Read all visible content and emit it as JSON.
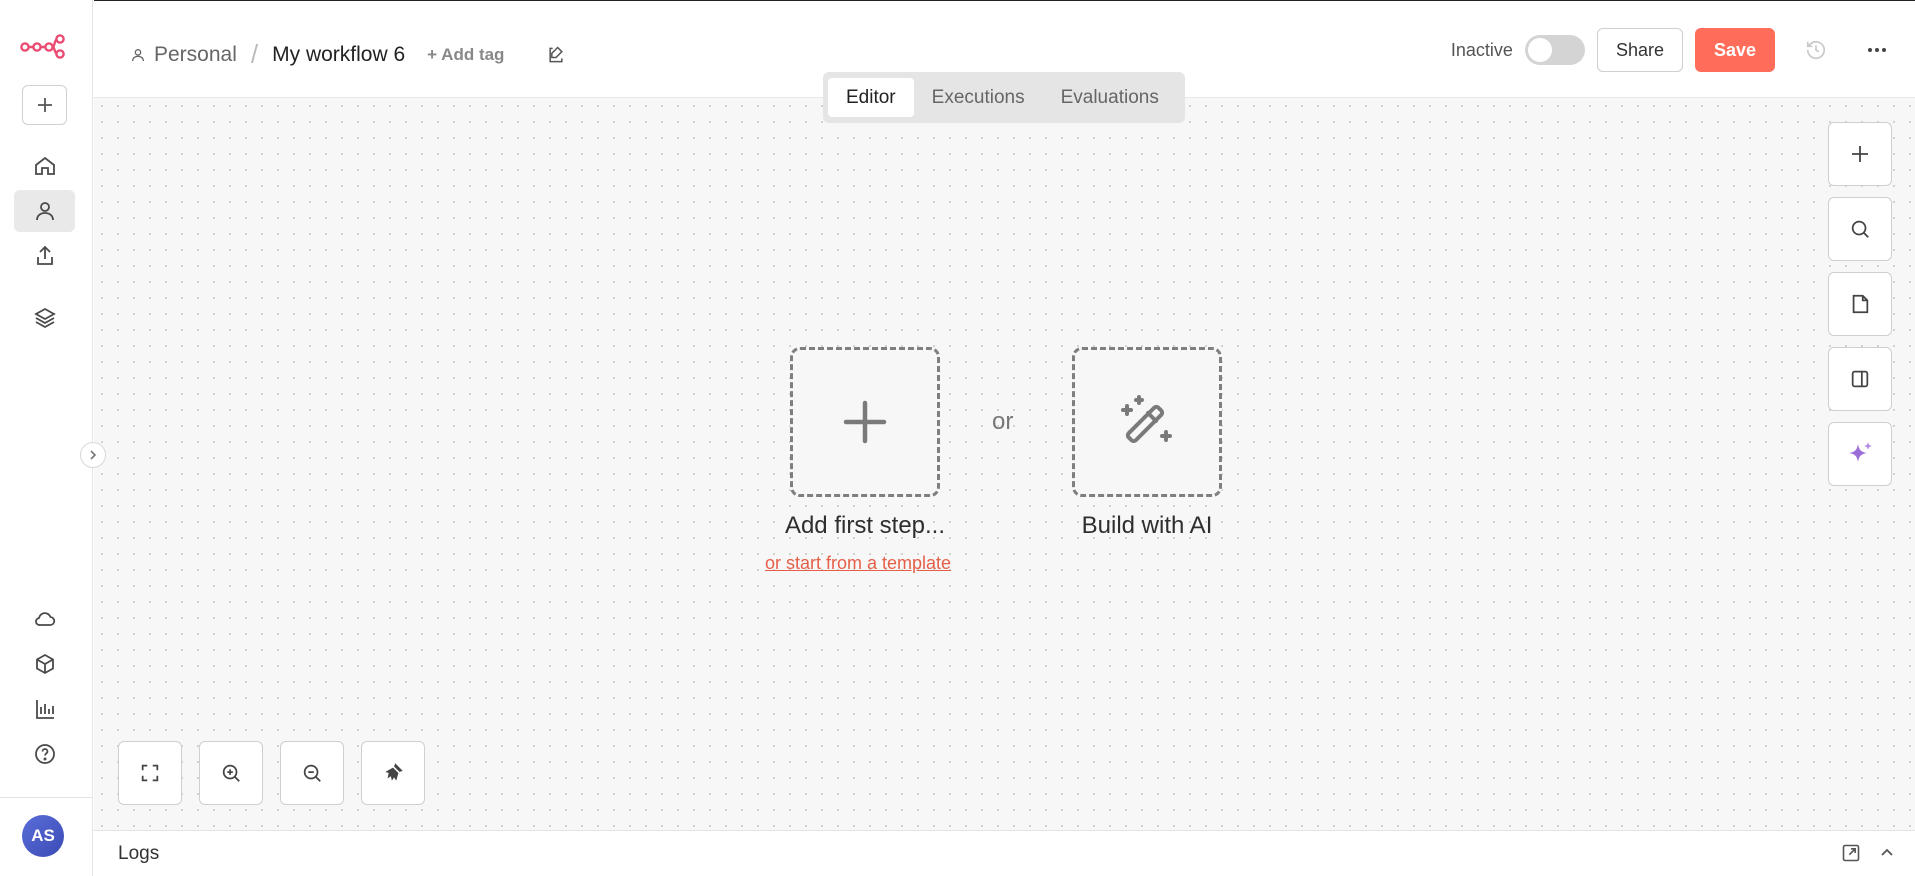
{
  "header": {
    "breadcrumb_project": "Personal",
    "breadcrumb_separator": "/",
    "workflow_name": "My workflow 6",
    "add_tag_label": "+ Add tag",
    "status_label": "Inactive",
    "share_label": "Share",
    "save_label": "Save"
  },
  "tabs": [
    {
      "label": "Editor",
      "active": true
    },
    {
      "label": "Executions",
      "active": false
    },
    {
      "label": "Evaluations",
      "active": false
    }
  ],
  "canvas": {
    "add_first_step_label": "Add first step...",
    "or_label": "or",
    "template_link_label": "or start from a template",
    "build_ai_label": "Build with AI"
  },
  "logs": {
    "label": "Logs"
  },
  "user": {
    "initials": "AS"
  },
  "colors": {
    "accent": "#ff6d5a",
    "logo": "#ea4b71",
    "ai_sparkle": "#9b6dd8"
  },
  "icons": {
    "sidebar": [
      "home-icon",
      "person-icon",
      "share-icon",
      "layers-icon",
      "cloud-icon",
      "box-icon",
      "chart-icon",
      "help-icon"
    ],
    "right_tools": [
      "plus-icon",
      "search-icon",
      "note-icon",
      "panel-icon",
      "ai-sparkle-icon"
    ],
    "bottom_tools": [
      "fit-view-icon",
      "zoom-in-icon",
      "zoom-out-icon",
      "clean-up-icon"
    ]
  }
}
